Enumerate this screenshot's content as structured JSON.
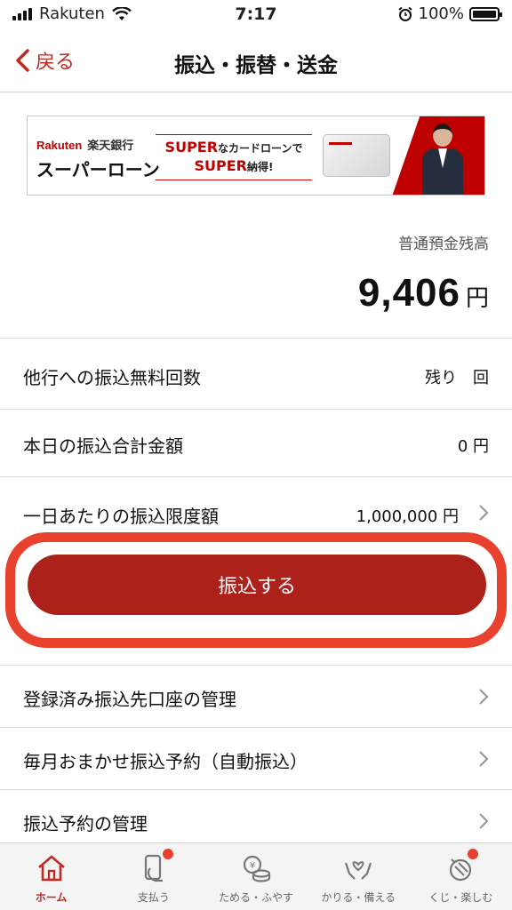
{
  "status_bar": {
    "carrier": "Rakuten",
    "time": "7:17",
    "battery": "100%",
    "battery_level": 1.0
  },
  "nav": {
    "back_label": "戻る",
    "title": "振込・振替・送金"
  },
  "banner": {
    "brand": "Rakuten",
    "brand_sub": "楽天銀行",
    "product": "スーパーローン",
    "copy_super1": "SUPER",
    "copy_line1_rest": "なカードローンで",
    "copy_super2": "SUPER",
    "copy_line2_rest": "納得!"
  },
  "balance": {
    "label": "普通預金残高",
    "amount": "9,406",
    "unit": "円"
  },
  "rows": {
    "free_transfers": {
      "label": "他行への振込無料回数",
      "value": "残り　回"
    },
    "today_total": {
      "label": "本日の振込合計金額",
      "value": "0 円"
    },
    "daily_limit": {
      "label": "一日あたりの振込限度額",
      "value": "1,000,000 円"
    },
    "registered": {
      "label": "登録済み振込先口座の管理"
    },
    "monthly": {
      "label": "毎月おまかせ振込予約（自動振込）"
    },
    "scheduled": {
      "label": "振込予約の管理"
    }
  },
  "cta": {
    "label": "振込する"
  },
  "tabs": [
    {
      "label": "ホーム",
      "icon": "home-icon",
      "active": true
    },
    {
      "label": "支払う",
      "icon": "pay-icon",
      "badge": true
    },
    {
      "label": "ためる・ふやす",
      "icon": "coins-icon"
    },
    {
      "label": "かりる・備える",
      "icon": "hands-icon"
    },
    {
      "label": "くじ・楽しむ",
      "icon": "lottery-icon",
      "badge": true
    }
  ],
  "colors": {
    "accent": "#bf2a22",
    "button": "#ad211b",
    "highlight": "#e8412e"
  }
}
